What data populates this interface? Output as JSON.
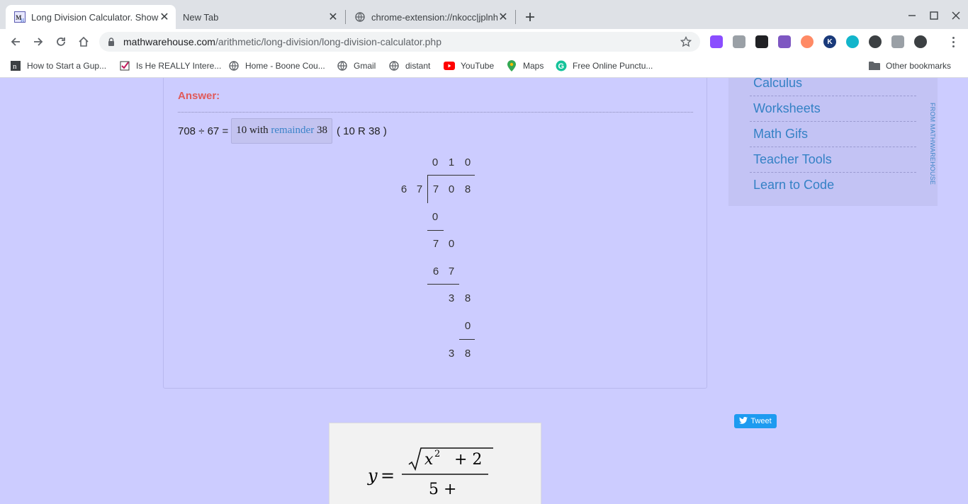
{
  "browser": {
    "tabs": [
      {
        "title": "Long Division Calculator. Shows",
        "active": true,
        "favicon": "mathwarehouse-icon"
      },
      {
        "title": "New Tab",
        "active": false,
        "favicon": ""
      },
      {
        "title": "chrome-extension://nkocc|jplnhp",
        "active": false,
        "favicon": "globe-icon"
      }
    ],
    "address": {
      "domain": "mathwarehouse.com",
      "path": "/arithmetic/long-division/long-division-calculator.php"
    },
    "bookmarks": [
      {
        "label": "How to Start a Gup...",
        "icon": "notion-icon"
      },
      {
        "label": "Is He REALLY Intere...",
        "icon": "checkbox-icon"
      },
      {
        "label": "Home - Boone Cou...",
        "icon": "globe-icon"
      },
      {
        "label": "Gmail",
        "icon": "globe-icon"
      },
      {
        "label": "distant",
        "icon": "globe-icon"
      },
      {
        "label": "YouTube",
        "icon": "youtube-icon"
      },
      {
        "label": "Maps",
        "icon": "maps-pin-icon"
      },
      {
        "label": "Free Online Punctu...",
        "icon": "grammarly-icon"
      }
    ],
    "other_bookmarks": "Other bookmarks"
  },
  "answer": {
    "label": "Answer:",
    "equation": "708 ÷ 67 =",
    "quotient": "10",
    "with_text": "with",
    "remainder_word": "remainder",
    "remainder": "38",
    "short_form": "( 10 R 38 )"
  },
  "long_division": {
    "quotient_digits": [
      "0",
      "1",
      "0"
    ],
    "divisor_digits": [
      "6",
      "7"
    ],
    "dividend_digits": [
      "7",
      "0",
      "8"
    ],
    "step1_subtract": [
      "0"
    ],
    "step1_result": [
      "7",
      "0"
    ],
    "step2_subtract": [
      "6",
      "7"
    ],
    "step2_result": [
      "3",
      "8"
    ],
    "step3_subtract": [
      "0"
    ],
    "final_remainder": [
      "3",
      "8"
    ]
  },
  "sidebar": {
    "items": [
      "Calculus",
      "Worksheets",
      "Math Gifs",
      "Teacher Tools",
      "Learn to Code"
    ],
    "vertical_label": "FROM MATHWAREHOUSE"
  },
  "tweet_label": "Tweet",
  "formula": {
    "lhs": "y =",
    "numerator_var": "x",
    "numerator_exp": "2",
    "numerator_rest": "+ 2",
    "denominator": "5 +"
  }
}
